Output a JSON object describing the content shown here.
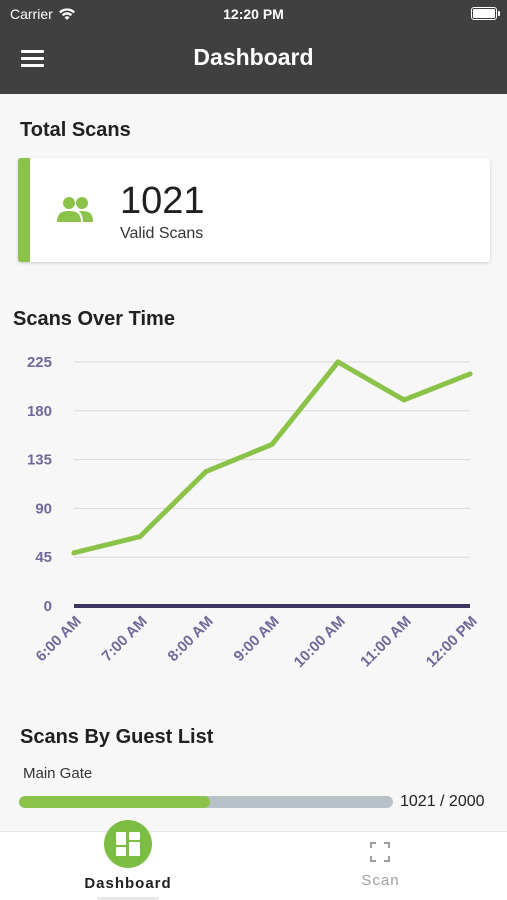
{
  "status_bar": {
    "carrier": "Carrier",
    "time": "12:20 PM"
  },
  "nav": {
    "title": "Dashboard",
    "menu_icon": "hamburger-menu-icon"
  },
  "total_scans": {
    "section_title": "Total Scans",
    "value": "1021",
    "label": "Valid Scans",
    "icon": "people-icon",
    "accent_color": "#8bc34a"
  },
  "scans_over_time": {
    "section_title": "Scans Over Time"
  },
  "chart_data": {
    "type": "line",
    "title": "Scans Over Time",
    "categories": [
      "6:00 AM",
      "7:00 AM",
      "8:00 AM",
      "9:00 AM",
      "10:00 AM",
      "11:00 AM",
      "12:00 PM"
    ],
    "values": [
      49,
      64,
      124,
      149,
      225,
      190,
      214
    ],
    "ylim": [
      0,
      225
    ],
    "yticks": [
      "225",
      "180",
      "135",
      "90",
      "45",
      "0"
    ],
    "grid": true,
    "line_color": "#8bc34a",
    "axis_color": "#3b3760"
  },
  "guest_list": {
    "section_title": "Scans By Guest List",
    "items": [
      {
        "name": "Main Gate",
        "progress_text": "1021 / 2000",
        "fraction": 0.5105
      }
    ]
  },
  "tabbar": {
    "tabs": [
      {
        "label": "Dashboard",
        "icon": "dashboard-icon",
        "active": true
      },
      {
        "label": "Scan",
        "icon": "scan-icon",
        "active": false
      }
    ]
  }
}
